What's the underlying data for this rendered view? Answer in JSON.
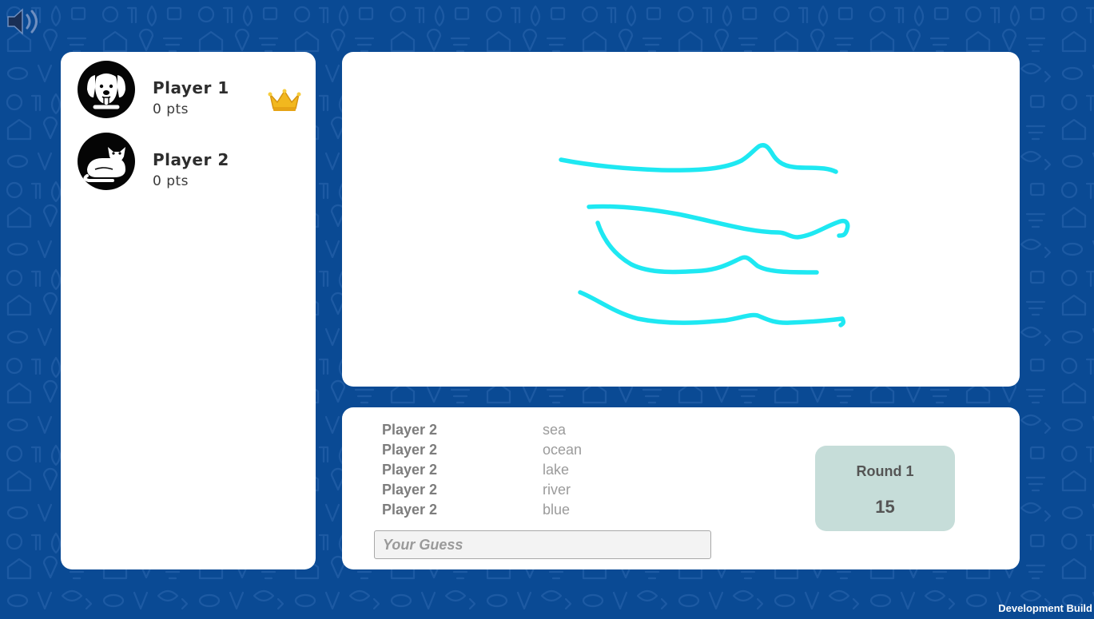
{
  "players": [
    {
      "name": "Player 1",
      "points": "0 pts",
      "avatar": "dog-icon",
      "leader": true
    },
    {
      "name": "Player 2",
      "points": "0 pts",
      "avatar": "cat-icon",
      "leader": false
    }
  ],
  "drawing": {
    "stroke_color": "#1ee8f2"
  },
  "guesses": [
    {
      "player": "Player 2",
      "word": "sea"
    },
    {
      "player": "Player 2",
      "word": "ocean"
    },
    {
      "player": "Player 2",
      "word": "lake"
    },
    {
      "player": "Player 2",
      "word": "river"
    },
    {
      "player": "Player 2",
      "word": "blue"
    }
  ],
  "guess_input": {
    "placeholder": "Your Guess",
    "value": ""
  },
  "round": {
    "label": "Round 1",
    "timer": "15"
  },
  "footer": {
    "build_label": "Development Build"
  },
  "colors": {
    "background": "#0a4a94",
    "panel": "#ffffff",
    "round_box": "#c6ddd9",
    "crown": "#f2b81e"
  },
  "icons": {
    "sound": "speaker-icon",
    "leader": "crown-icon"
  }
}
